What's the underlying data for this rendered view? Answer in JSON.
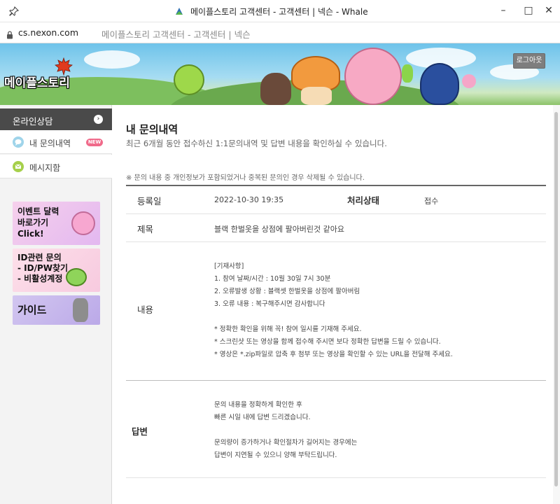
{
  "window": {
    "title": "메이플스토리 고객센터 - 고객센터 | 넥슨 - Whale"
  },
  "address": {
    "host": "cs.nexon.com",
    "page_title": "메이플스토리 고객센터 - 고객센터 | 넥슨"
  },
  "banner": {
    "logo_text": "메이플스토리",
    "logout_label": "로그아웃"
  },
  "sidebar": {
    "header": "온라인상담",
    "items": [
      {
        "label": "내 문의내역",
        "badge": "NEW"
      },
      {
        "label": "메시지함"
      }
    ],
    "promos": [
      {
        "text": "이벤트 달력\n바로가기\nClick!"
      },
      {
        "text": "ID관련 문의\n- ID/PW찾기\n- 비활성계정"
      },
      {
        "text": "가이드"
      }
    ]
  },
  "main": {
    "title": "내 문의내역",
    "subtitle": "최근 6개월 동안 접수하신 1:1문의내역 및 답변 내용을 확인하실 수 있습니다.",
    "note": "※ 문의 내용 중 개인정보가 포함되었거나 중복된 문의인 경우 삭제될 수 있습니다.",
    "registered_label": "등록일",
    "registered_value": "2022-10-30 19:35",
    "status_label": "처리상태",
    "status_value": "접수",
    "subject_label": "제목",
    "subject_value": "블랙 한벌옷을 상점에 팔아버린것 같아요",
    "content_label": "내용",
    "content_lines": [
      "[기재사항]",
      "1. 참여 날짜/시간 : 10월 30일 7시 30분",
      "2. 오류발생 상황 : 블랙셋 한벌옷을 상점에 팔아버림",
      "3. 오류 내용 : 복구해주시면 감사합니다",
      "",
      "* 정확한 확인을 위해 꼭! 참여 일시를 기재해 주세요.",
      "* 스크린샷 또는 영상을 함께 접수해 주시면 보다 정확한 답변을 드릴 수 있습니다.",
      "* 영상은 *.zip파일로 압축 후 첨부 또는 영상을 확인할 수 있는 URL을 전달해 주세요."
    ],
    "answer_label": "답변",
    "answer_lines": [
      "문의 내용을 정확하게 확인한 후",
      "빠른 시일 내에 답변 드리겠습니다.",
      "",
      "문의량이 증가하거나 확인절차가 길어지는 경우에는",
      "답변이 지연될 수 있으니 양해 부탁드립니다."
    ]
  },
  "colors": {
    "sidebar_header": "#4a4a4a",
    "badge": "#f06a8a"
  }
}
